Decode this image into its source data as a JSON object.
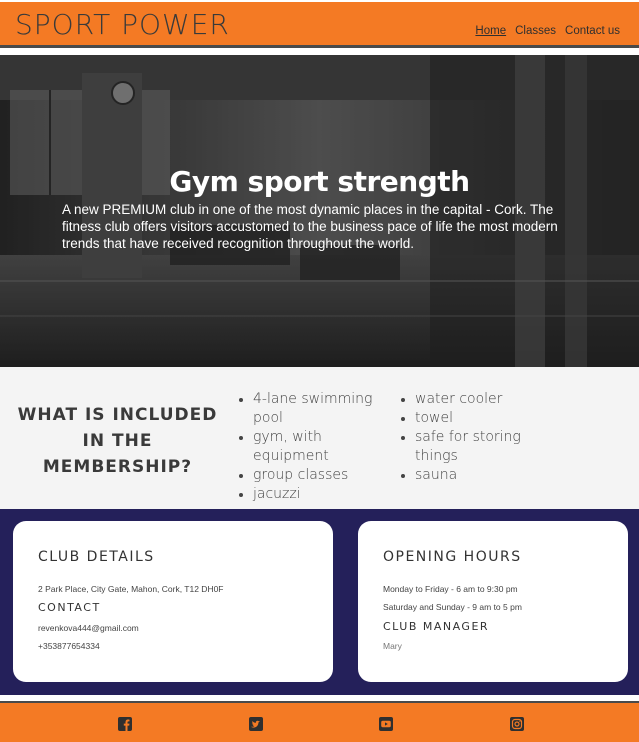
{
  "header": {
    "logo": "SPORT POWER",
    "nav": [
      "Home",
      "Classes",
      "Contact us"
    ]
  },
  "hero": {
    "title": "Gym sport strength",
    "text": "A new PREMIUM club in one of the most dynamic places in the capital - Cork. The fitness club offers visitors accustomed to the business pace of life the most modern trends that have received recognition throughout the world."
  },
  "membership": {
    "title": "WHAT IS INCLUDED IN THE MEMBERSHIP?",
    "items_a": [
      "4-lane swimming pool",
      "gym, with equipment",
      "group classes",
      "jacuzzi"
    ],
    "items_b": [
      "water cooler",
      "towel",
      "safe for storing things",
      "sauna"
    ]
  },
  "club_details": {
    "title": "CLUB DETAILS",
    "address": "2 Park Place, City Gate, Mahon, Cork, T12 DH0F",
    "contact_title": "CONTACT",
    "email": "revenkova444@gmail.com",
    "phone": "+353877654334"
  },
  "opening_hours": {
    "title": "OPENING HOURS",
    "weekdays": "Monday to Friday - 6 am to 9:30 pm",
    "weekend": "Saturday and Sunday - 9 am to 5 pm",
    "manager_title": "CLUB MANAGER",
    "manager_name": "Mary"
  },
  "footer": {
    "icons": [
      "facebook-icon",
      "twitter-icon",
      "youtube-icon",
      "instagram-icon"
    ]
  },
  "colors": {
    "brand_orange": "#f47a24",
    "navy": "#24205a",
    "light_gray": "#f4f4f4"
  }
}
